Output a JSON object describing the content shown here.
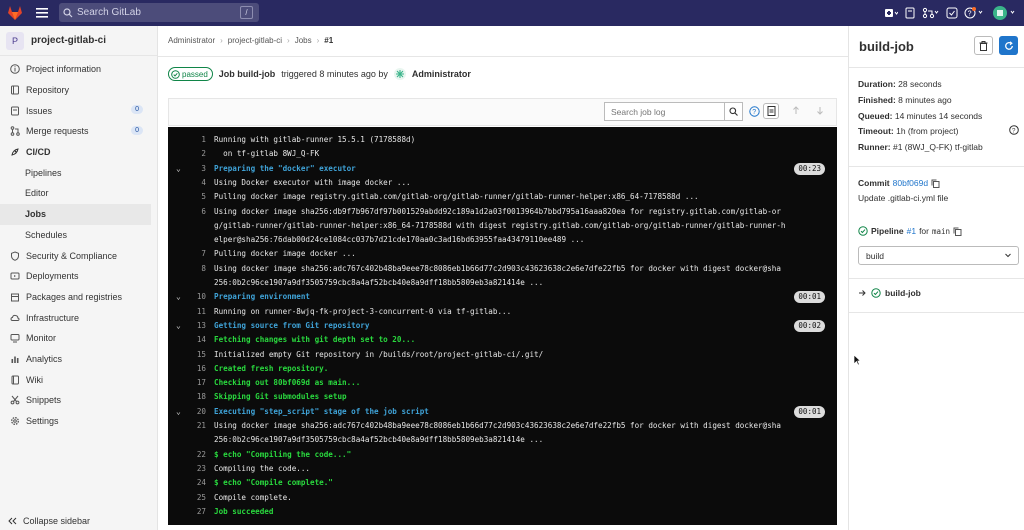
{
  "topbar": {
    "search_placeholder": "Search GitLab",
    "search_shortcut": "/"
  },
  "sidebar": {
    "project_initial": "P",
    "project_name": "project-gitlab-ci",
    "items": [
      {
        "label": "Project information",
        "icon": "info-icon"
      },
      {
        "label": "Repository",
        "icon": "repo-icon"
      },
      {
        "label": "Issues",
        "icon": "issues-icon",
        "badge": "0"
      },
      {
        "label": "Merge requests",
        "icon": "merge-icon",
        "badge": "0"
      },
      {
        "label": "CI/CD",
        "icon": "rocket-icon"
      },
      {
        "label": "Pipelines"
      },
      {
        "label": "Editor"
      },
      {
        "label": "Jobs"
      },
      {
        "label": "Schedules"
      },
      {
        "label": "Security & Compliance",
        "icon": "shield-icon"
      },
      {
        "label": "Deployments",
        "icon": "deploy-icon"
      },
      {
        "label": "Packages and registries",
        "icon": "package-icon"
      },
      {
        "label": "Infrastructure",
        "icon": "cloud-icon"
      },
      {
        "label": "Monitor",
        "icon": "monitor-icon"
      },
      {
        "label": "Analytics",
        "icon": "chart-icon"
      },
      {
        "label": "Wiki",
        "icon": "book-icon"
      },
      {
        "label": "Snippets",
        "icon": "scissors-icon"
      },
      {
        "label": "Settings",
        "icon": "gear-icon"
      }
    ],
    "collapse_label": "Collapse sidebar"
  },
  "breadcrumb": [
    "Administrator",
    "project-gitlab-ci",
    "Jobs",
    "#1"
  ],
  "job_header": {
    "status": "passed",
    "job_prefix": "Job build-job",
    "triggered": "triggered 8 minutes ago by",
    "user": "Administrator"
  },
  "log_toolbar": {
    "search_placeholder": "Search job log"
  },
  "log": [
    {
      "n": "1",
      "t": "Running with gitlab-runner 15.5.1 (7178588d)",
      "c": ""
    },
    {
      "n": "2",
      "t": "  on tf-gitlab 8WJ_Q-FK",
      "c": ""
    },
    {
      "n": "3",
      "t": "Preparing the \"docker\" executor",
      "c": "sec",
      "chev": "⌄",
      "dur": "00:23"
    },
    {
      "n": "4",
      "t": "Using Docker executor with image docker ...",
      "c": ""
    },
    {
      "n": "5",
      "t": "Pulling docker image registry.gitlab.com/gitlab-org/gitlab-runner/gitlab-runner-helper:x86_64-7178588d ...",
      "c": ""
    },
    {
      "n": "6",
      "t": "Using docker image sha256:db9f7b967df97b001529abdd92c189a1d2a03f0013964b7bbd795a16aaa820ea for registry.gitlab.com/gitlab-or",
      "c": ""
    },
    {
      "n": "",
      "t": "g/gitlab-runner/gitlab-runner-helper:x86_64-7178588d with digest registry.gitlab.com/gitlab-org/gitlab-runner/gitlab-runner-h",
      "c": ""
    },
    {
      "n": "",
      "t": "elper@sha256:76dab00d24ce1084cc037b7d21cde170aa0c3ad16bd63955faa43479110ee489 ...",
      "c": ""
    },
    {
      "n": "7",
      "t": "Pulling docker image docker ...",
      "c": ""
    },
    {
      "n": "8",
      "t": "Using docker image sha256:adc767c402b48ba9eee78c8086eb1b66d77c2d903c43623638c2e6e7dfe22fb5 for docker with digest docker@sha",
      "c": ""
    },
    {
      "n": "",
      "t": "256:0b2c96ce1907a9df3505759cbc8a4af52bcb40e8a9dff18bb5809eb3a821414e ...",
      "c": ""
    },
    {
      "n": "10",
      "t": "Preparing environment",
      "c": "sec",
      "chev": "⌄",
      "dur": "00:01"
    },
    {
      "n": "11",
      "t": "Running on runner-8wjq-fk-project-3-concurrent-0 via tf-gitlab...",
      "c": ""
    },
    {
      "n": "13",
      "t": "Getting source from Git repository",
      "c": "sec",
      "chev": "⌄",
      "dur": "00:02"
    },
    {
      "n": "14",
      "t": "Fetching changes with git depth set to 20...",
      "c": "grn"
    },
    {
      "n": "15",
      "t": "Initialized empty Git repository in /builds/root/project-gitlab-ci/.git/",
      "c": ""
    },
    {
      "n": "16",
      "t": "Created fresh repository.",
      "c": "grn"
    },
    {
      "n": "17",
      "t": "Checking out 80bf069d as main...",
      "c": "grn"
    },
    {
      "n": "18",
      "t": "Skipping Git submodules setup",
      "c": "grn"
    },
    {
      "n": "20",
      "t": "Executing \"step_script\" stage of the job script",
      "c": "sec",
      "chev": "⌄",
      "dur": "00:01"
    },
    {
      "n": "21",
      "t": "Using docker image sha256:adc767c402b48ba9eee78c8086eb1b66d77c2d903c43623638c2e6e7dfe22fb5 for docker with digest docker@sha",
      "c": ""
    },
    {
      "n": "",
      "t": "256:0b2c96ce1907a9df3505759cbc8a4af52bcb40e8a9dff18bb5809eb3a821414e ...",
      "c": ""
    },
    {
      "n": "22",
      "t": "$ echo \"Compiling the code...\"",
      "c": "grn"
    },
    {
      "n": "23",
      "t": "Compiling the code...",
      "c": ""
    },
    {
      "n": "24",
      "t": "$ echo \"Compile complete.\"",
      "c": "grn"
    },
    {
      "n": "25",
      "t": "Compile complete.",
      "c": ""
    },
    {
      "n": "27",
      "t": "Job succeeded",
      "c": "grn"
    }
  ],
  "right": {
    "title": "build-job",
    "duration_label": "Duration:",
    "duration": "28 seconds",
    "finished_label": "Finished:",
    "finished": "8 minutes ago",
    "queued_label": "Queued:",
    "queued": "14 minutes 14 seconds",
    "timeout_label": "Timeout:",
    "timeout": "1h (from project)",
    "runner_label": "Runner:",
    "runner": "#1 (8WJ_Q-FK) tf-gitlab",
    "commit_label": "Commit",
    "commit": "80bf069d",
    "commit_msg": "Update .gitlab-ci.yml file",
    "pipeline_label": "Pipeline",
    "pipeline_num": "#1",
    "pipeline_for": "for",
    "pipeline_ref": "main",
    "stage_select": "build",
    "job_item": "build-job"
  },
  "colors": {
    "topbar": "#292961",
    "success": "#108548",
    "link": "#1f75cb",
    "log_bg": "#0b0b0b"
  }
}
